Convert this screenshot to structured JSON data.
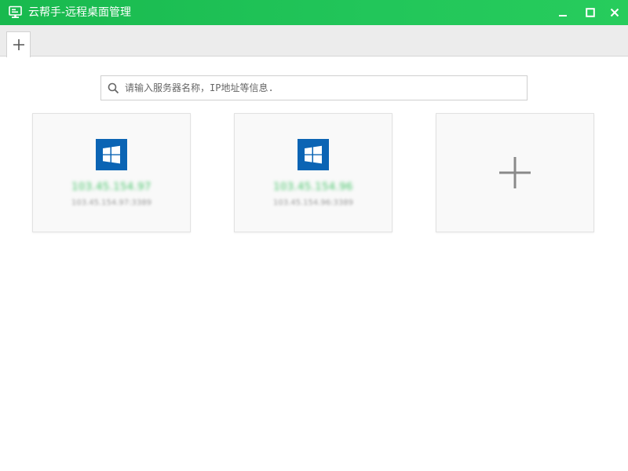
{
  "window": {
    "title": "云帮手-远程桌面管理",
    "accent": "#22c65a"
  },
  "tabbar": {
    "add_icon": "plus-icon"
  },
  "search": {
    "placeholder": "请输入服务器名称，IP地址等信息.",
    "value": ""
  },
  "servers": [
    {
      "os_icon": "windows-icon",
      "name": "103.45.154.97",
      "address": "103.45.154.97:3389",
      "name_color": "#3fc264"
    },
    {
      "os_icon": "windows-icon",
      "name": "103.45.154.96",
      "address": "103.45.154.96:3389",
      "name_color": "#3fc264"
    }
  ],
  "add_card": {
    "icon": "plus-icon"
  }
}
